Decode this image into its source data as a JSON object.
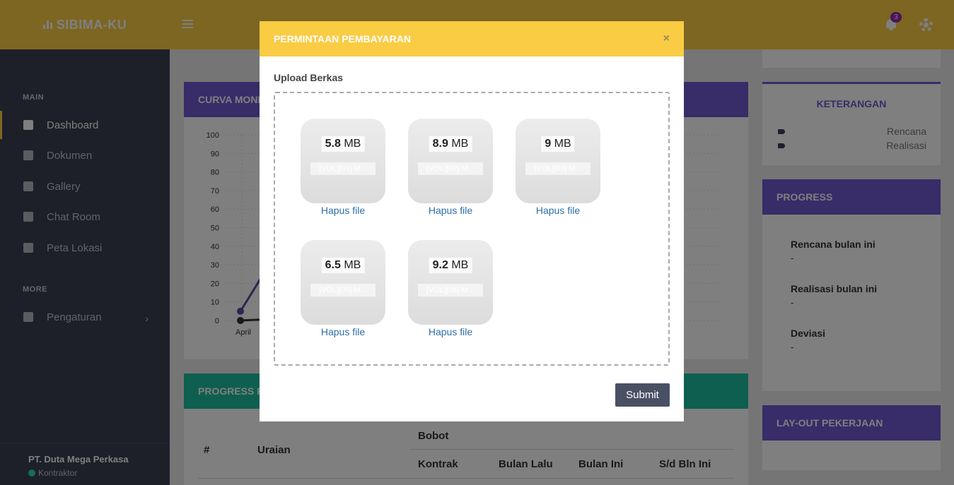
{
  "brand": {
    "title": "SIBIMA-KU"
  },
  "topbar": {
    "notification_count": "3"
  },
  "sidebar": {
    "section_main": "MAIN",
    "items": [
      {
        "label": "Dashboard"
      },
      {
        "label": "Dokumen"
      },
      {
        "label": "Gallery"
      },
      {
        "label": "Chat Room"
      },
      {
        "label": "Peta Lokasi"
      }
    ],
    "section_more": "MORE",
    "more_items": [
      {
        "label": "Pengaturan"
      }
    ],
    "company": "PT. Duta Mega Perkasa",
    "role": "Kontraktor"
  },
  "chart_card": {
    "title": "CURVA MONI"
  },
  "chart_data": {
    "type": "line",
    "yticks": [
      "100",
      "90",
      "80",
      "70",
      "60",
      "50",
      "40",
      "30",
      "20",
      "10",
      "0"
    ],
    "xticks": [
      "April"
    ],
    "ylim": [
      0,
      100
    ],
    "series": [
      {
        "color": "#5b4a9e",
        "x": [
          "April"
        ],
        "values": [
          5
        ]
      },
      {
        "color": "#333333",
        "x": [
          "April"
        ],
        "values": [
          0
        ]
      }
    ]
  },
  "progress_card": {
    "title": "PROGRESS F",
    "col_no": "#",
    "col_uraian": "Uraian",
    "col_bobot": "Bobot",
    "col_kontrak": "Kontrak",
    "col_bulan_lalu": "Bulan Lalu",
    "col_bulan_ini": "Bulan Ini",
    "col_sd": "S/d Bln Ini"
  },
  "keterangan": {
    "title": "KETERANGAN",
    "rows": [
      {
        "label": "Rencana"
      },
      {
        "label": "Realisasi"
      }
    ]
  },
  "progress_side": {
    "title": "PROGRESS",
    "items": [
      {
        "label": "Rencana bulan ini",
        "value": "-"
      },
      {
        "label": "Realisasi bulan ini",
        "value": "-"
      },
      {
        "label": "Deviasi",
        "value": "-"
      }
    ]
  },
  "layout_card": {
    "title": "LAY-OUT PEKERJAAN"
  },
  "modal": {
    "title": "PERMINTAAN PEMBAYARAN",
    "close": "×",
    "upload_label": "Upload Berkas",
    "files": [
      {
        "size": "5.8",
        "unit": "MB",
        "name": "[VOL][01] M...",
        "remove": "Hapus file"
      },
      {
        "size": "8.9",
        "unit": "MB",
        "name": "[VOL][02] M...",
        "remove": "Hapus file"
      },
      {
        "size": "9",
        "unit": "MB",
        "name": "[VOL][03] M...",
        "remove": "Hapus file"
      },
      {
        "size": "6.5",
        "unit": "MB",
        "name": "[VOL][05] M...",
        "remove": "Hapus file"
      },
      {
        "size": "9.2",
        "unit": "MB",
        "name": "[VOL][06] M...",
        "remove": "Hapus file"
      }
    ],
    "submit": "Submit"
  }
}
